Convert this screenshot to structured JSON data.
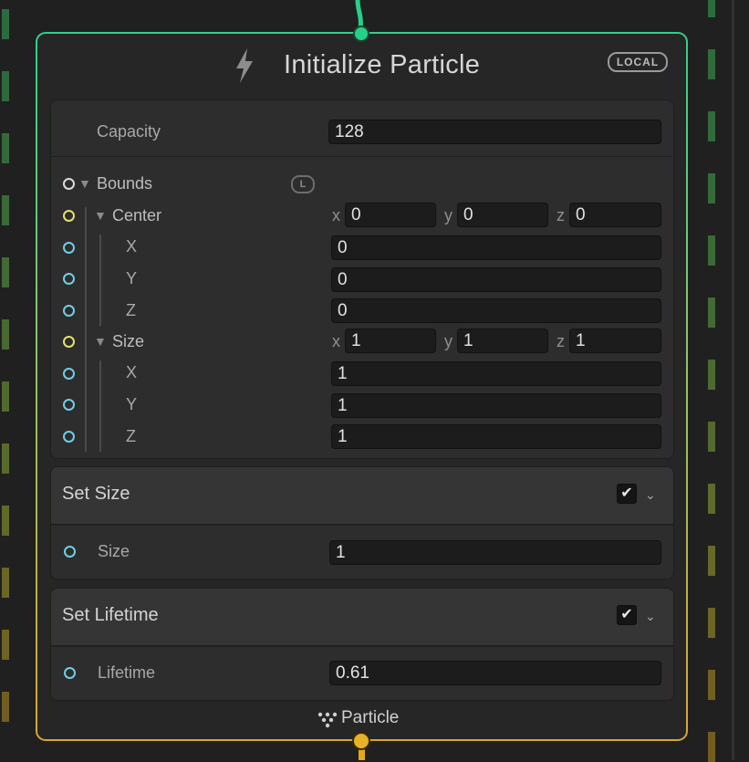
{
  "node": {
    "title": "Initialize Particle",
    "space_badge": "LOCAL",
    "output_label": "Particle",
    "border_colors": {
      "top": "#2fcf8a",
      "bottom": "#d8a536"
    }
  },
  "capacity": {
    "label": "Capacity",
    "value": "128"
  },
  "bounds": {
    "label": "Bounds",
    "space_badge": "L",
    "center": {
      "label": "Center",
      "compact": {
        "x_label": "x",
        "x": "0",
        "y_label": "y",
        "y": "0",
        "z_label": "z",
        "z": "0"
      },
      "rows": [
        {
          "label": "X",
          "value": "0"
        },
        {
          "label": "Y",
          "value": "0"
        },
        {
          "label": "Z",
          "value": "0"
        }
      ]
    },
    "size": {
      "label": "Size",
      "compact": {
        "x_label": "x",
        "x": "1",
        "y_label": "y",
        "y": "1",
        "z_label": "z",
        "z": "1"
      },
      "rows": [
        {
          "label": "X",
          "value": "1"
        },
        {
          "label": "Y",
          "value": "1"
        },
        {
          "label": "Z",
          "value": "1"
        }
      ]
    }
  },
  "blocks": [
    {
      "title": "Set Size",
      "enabled": true,
      "field_label": "Size",
      "field_value": "1"
    },
    {
      "title": "Set Lifetime",
      "enabled": true,
      "field_label": "Lifetime",
      "field_value": "0.61"
    }
  ],
  "icons": {
    "context": "lightning-icon",
    "checkbox": "checkmark-icon",
    "collapse": "chevron-down-icon",
    "output": "particle-icon",
    "checkmark_glyph": "✔",
    "chevron_glyph": "⌄",
    "triangle_glyph": "▼"
  }
}
